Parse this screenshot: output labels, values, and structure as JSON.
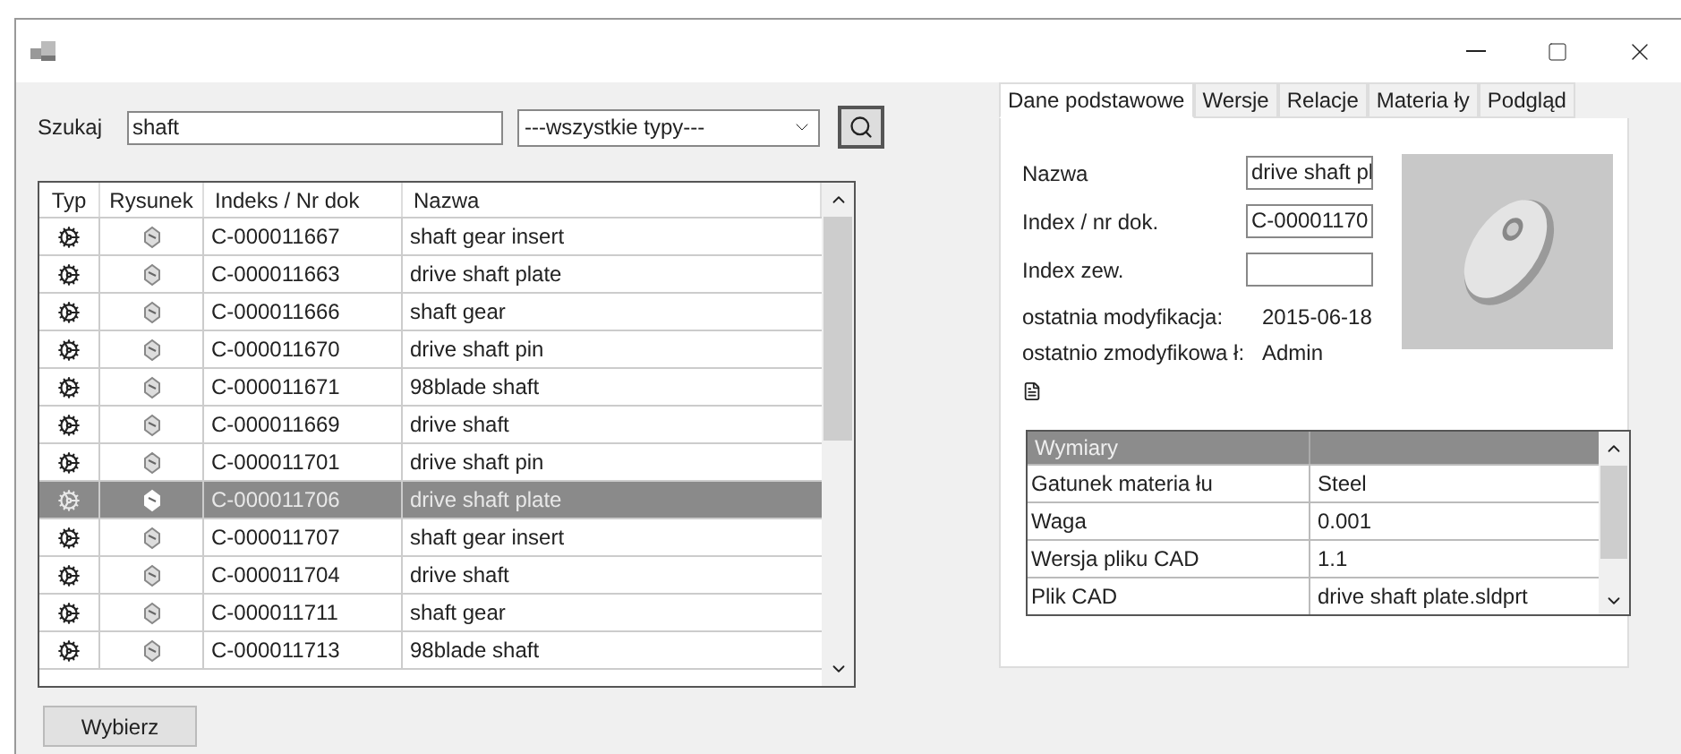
{
  "search": {
    "label": "Szukaj",
    "value": "shaft",
    "type_filter": "---wszystkie typy---"
  },
  "table": {
    "columns": [
      "Typ",
      "Rysunek",
      "Indeks / Nr dok",
      "Nazwa"
    ],
    "rows": [
      {
        "index": "C-000011667",
        "name": "shaft gear insert",
        "selected": false
      },
      {
        "index": "C-000011663",
        "name": "drive shaft plate",
        "selected": false
      },
      {
        "index": "C-000011666",
        "name": "shaft gear",
        "selected": false
      },
      {
        "index": "C-000011670",
        "name": "drive shaft pin",
        "selected": false
      },
      {
        "index": "C-000011671",
        "name": "98blade shaft",
        "selected": false
      },
      {
        "index": "C-000011669",
        "name": "drive shaft",
        "selected": false
      },
      {
        "index": "C-000011701",
        "name": "drive shaft pin",
        "selected": false
      },
      {
        "index": "C-000011706",
        "name": "drive shaft plate",
        "selected": true
      },
      {
        "index": "C-000011707",
        "name": "shaft gear insert",
        "selected": false
      },
      {
        "index": "C-000011704",
        "name": "drive shaft",
        "selected": false
      },
      {
        "index": "C-000011711",
        "name": "shaft gear",
        "selected": false
      },
      {
        "index": "C-000011713",
        "name": "98blade shaft",
        "selected": false
      }
    ]
  },
  "select_button": "Wybierz",
  "tabs": [
    {
      "label": "Dane podstawowe",
      "selected": true
    },
    {
      "label": "Wersje",
      "selected": false
    },
    {
      "label": "Relacje",
      "selected": false
    },
    {
      "label": "Materia ły",
      "selected": false
    },
    {
      "label": "Podgląd",
      "selected": false
    }
  ],
  "details": {
    "fields": [
      {
        "label": "Nazwa",
        "value": "drive shaft pl"
      },
      {
        "label": "Index / nr dok.",
        "value": "C-00001170"
      },
      {
        "label": "Index zew."
      }
    ],
    "info": [
      {
        "label": "ostatnia modyfikacja:",
        "value": "2015-06-18"
      },
      {
        "label": "ostatnio zmodyfikowa ł:",
        "value": "Admin"
      }
    ]
  },
  "properties": {
    "header": "Wymiary",
    "rows": [
      {
        "name": "Gatunek materia łu",
        "value": "Steel"
      },
      {
        "name": "Waga",
        "value": "0.001"
      },
      {
        "name": "Wersja pliku CAD",
        "value": "1.1"
      },
      {
        "name": "Plik CAD",
        "value": "drive shaft plate.sldprt"
      }
    ]
  }
}
